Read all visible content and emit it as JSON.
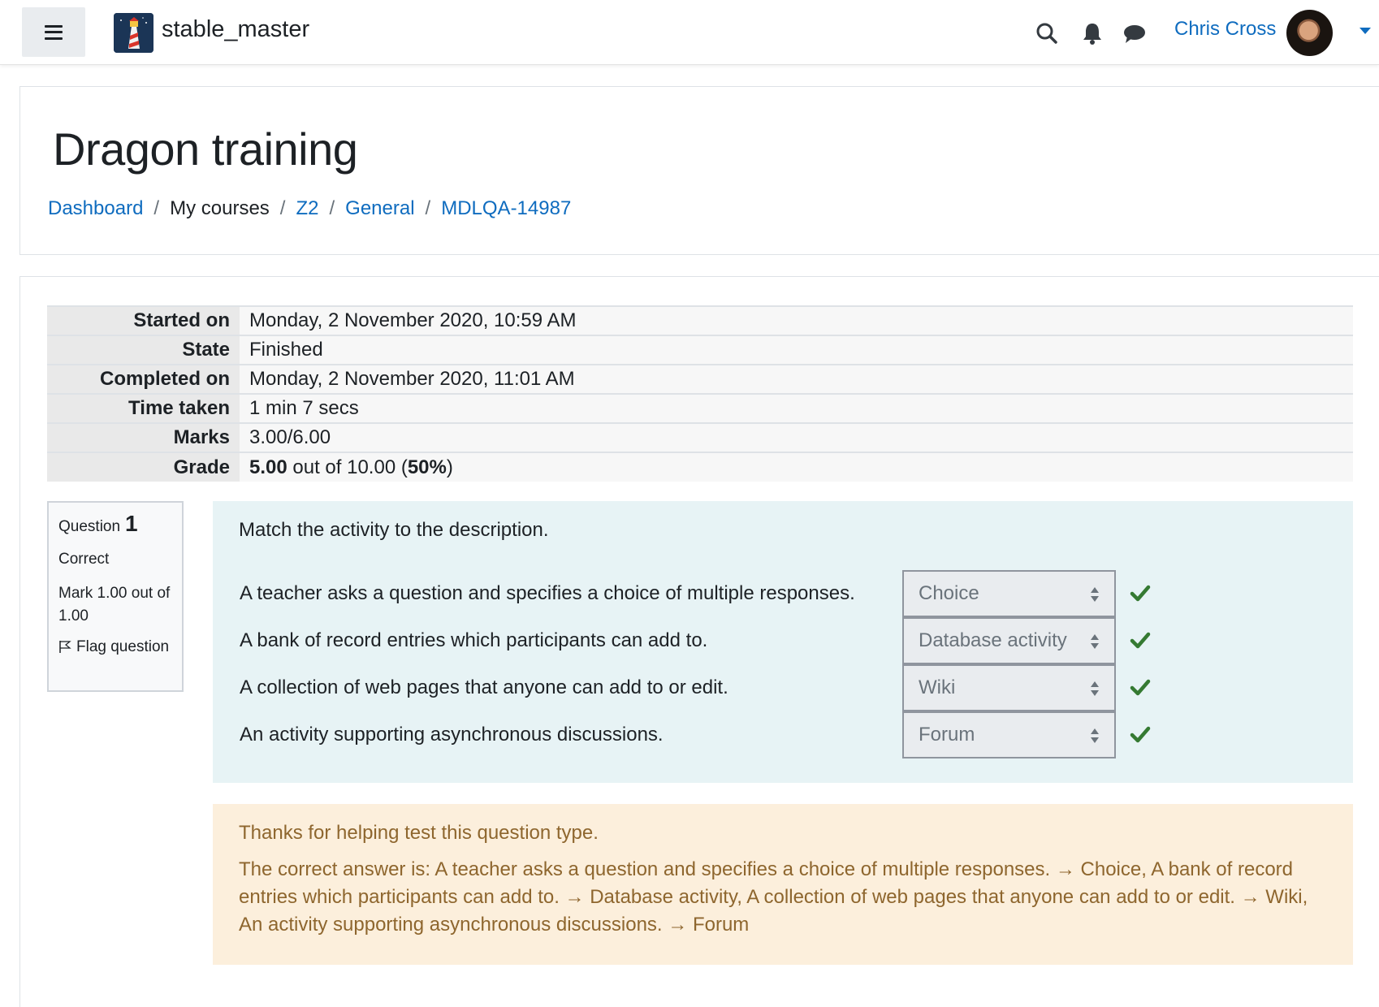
{
  "navbar": {
    "site_name": "stable_master",
    "user_name": "Chris Cross",
    "icons": [
      "menu-icon",
      "search-icon",
      "bell-icon",
      "chat-icon",
      "chevron-down-icon"
    ]
  },
  "header": {
    "title": "Dragon training",
    "breadcrumb": [
      "Dashboard",
      "My courses",
      "Z2",
      "General",
      "MDLQA-14987"
    ]
  },
  "summary": {
    "started_label": "Started on",
    "started_value": "Monday, 2 November 2020, 10:59 AM",
    "state_label": "State",
    "state_value": "Finished",
    "completed_label": "Completed on",
    "completed_value": "Monday, 2 November 2020, 11:01 AM",
    "time_label": "Time taken",
    "time_value": "1 min 7 secs",
    "marks_label": "Marks",
    "marks_value": "3.00/6.00",
    "grade_label": "Grade",
    "grade_score": "5.00",
    "grade_mid": "out of 10.00 (",
    "grade_percent": "50%",
    "grade_end": ")"
  },
  "question": {
    "label": "Question",
    "number": "1",
    "status": "Correct",
    "mark": "Mark 1.00 out of 1.00",
    "flag_label": "Flag question",
    "text": "Match the activity to the description.",
    "rows": [
      {
        "stem": "A teacher asks a question and specifies a choice of multiple responses.",
        "answer": "Choice"
      },
      {
        "stem": "A bank of record entries which participants can add to.",
        "answer": "Database activity"
      },
      {
        "stem": "A collection of web pages that anyone can add to or edit.",
        "answer": "Wiki"
      },
      {
        "stem": "An activity supporting asynchronous discussions.",
        "answer": "Forum"
      }
    ]
  },
  "feedback": {
    "general": "Thanks for helping test this question type.",
    "right_answer": "The correct answer is: A teacher asks a question and specifies a choice of multiple responses. → Choice, A bank of record entries which participants can add to. → Database activity, A collection of web pages that anyone can add to or edit. → Wiki, An activity supporting asynchronous discussions. → Forum"
  },
  "colors": {
    "link": "#0f6cbf",
    "question_bg": "#e7f3f5",
    "feedback_bg": "#fcefdc",
    "feedback_text": "#8e662e",
    "correct_green": "#357a32"
  }
}
